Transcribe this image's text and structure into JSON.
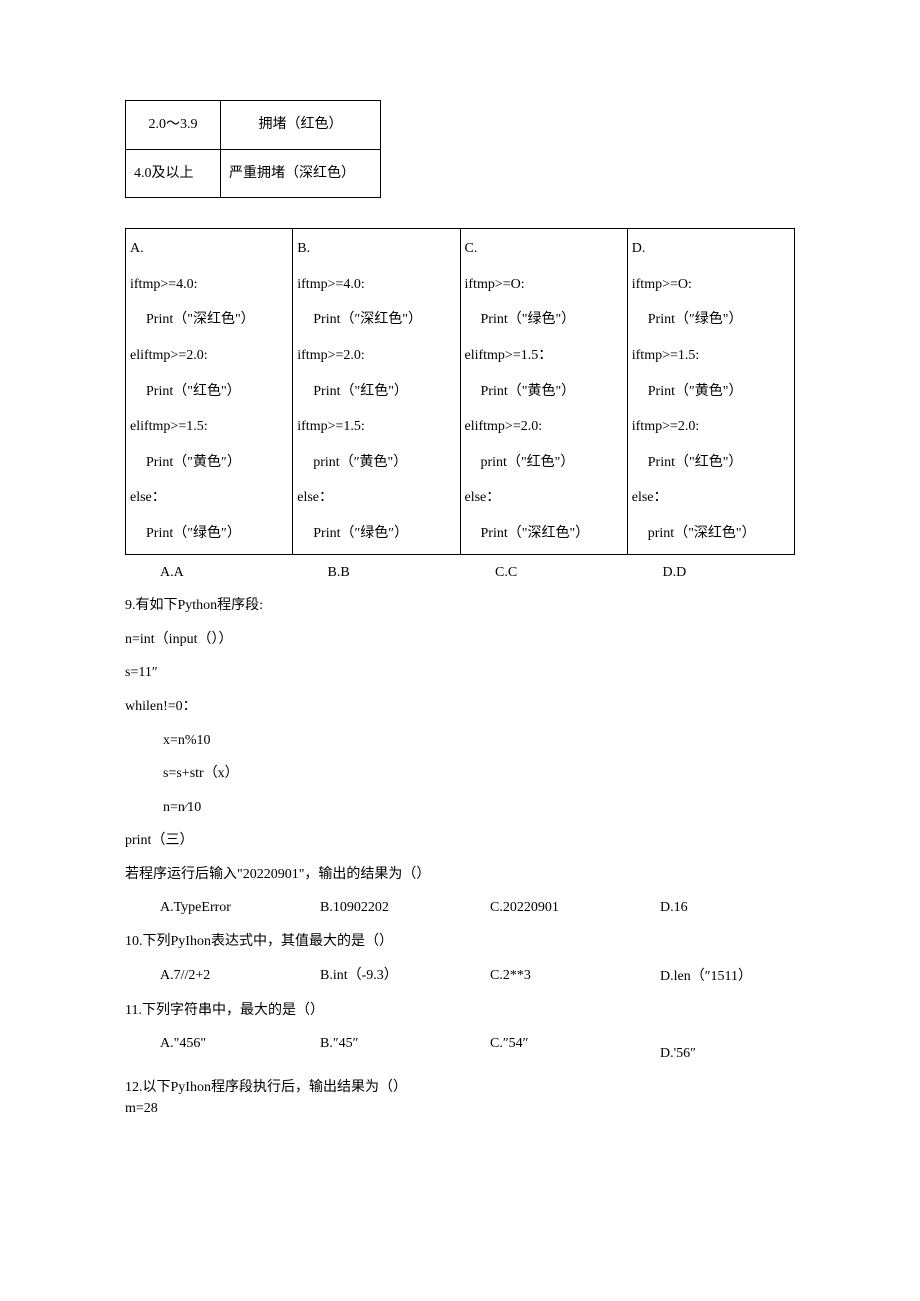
{
  "table1": {
    "r1c1": "2.0～3.9",
    "r1c2": "拥堵（红色）",
    "r2c1": "4.0及以上",
    "r2c2": "严重拥堵（深红色）"
  },
  "codeTable": {
    "A": {
      "header": "A.",
      "l1": "iftmp>=4.0:",
      "l2": "Print（\"深红色\"）",
      "l3": "eliftmp>=2.0:",
      "l4": "Print（\"红色\"）",
      "l5": "eliftmp>=1.5:",
      "l6": "Print（″黄色″）",
      "l7": "else：",
      "l8": "Print（″绿色″）"
    },
    "B": {
      "header": "B.",
      "l1": "iftmp>=4.0:",
      "l2": "Print（″深红色\"）",
      "l3": "iftmp>=2.0:",
      "l4": "Print（\"红色\"）",
      "l5": "iftmp>=1.5:",
      "l6": "print（″黄色\"）",
      "l7": "else：",
      "l8": "Print（″绿色″）"
    },
    "C": {
      "header": "C.",
      "l1": "iftmp>=O:",
      "l2": "Print（\"绿色\"）",
      "l3": "eliftmp>=1.5：",
      "l4": "Print（\"黄色\"）",
      "l5": "eliftmp>=2.0:",
      "l6": "print（\"红色\"）",
      "l7": "else：",
      "l8": "Print（\"深红色\"）"
    },
    "D": {
      "header": "D.",
      "l1": "iftmp>=O:",
      "l2": "Print（″绿色\"）",
      "l3": "iftmp>=1.5:",
      "l4": "Print（″黄色\"）",
      "l5": "iftmp>=2.0:",
      "l6": "Print（\"红色\"）",
      "l7": "else：",
      "l8": "print（\"深红色\"）"
    }
  },
  "opts8": {
    "A": "A.A",
    "B": "B.B",
    "C": "C.C",
    "D": "D.D"
  },
  "q9": {
    "title": "9.有如下Python程序段:",
    "l1": "n=int（input（））",
    "l2": "s=11″",
    "l3": "whilen!=0：",
    "l4": "x=n%10",
    "l5": "s=s+str（x）",
    "l6": "n=n⁄10",
    "l7": "print（三）",
    "prompt": "若程序运行后输入\"20220901\"，输出的结果为（）",
    "A": "A.TypeError",
    "B": "B.10902202",
    "C": "C.20220901",
    "D": "D.16"
  },
  "q10": {
    "title": "10.下列PyIhon表达式中，其值最大的是（）",
    "A": "A.7//2+2",
    "B": "B.int（-9.3）",
    "C": "C.2**3",
    "D": "D.len（″1511）"
  },
  "q11": {
    "title": "11.下列字符串中，最大的是（）",
    "A": "A.\"456\"",
    "B": "B.″45″",
    "C": "C.″54″",
    "D": "D.'56″"
  },
  "q12": {
    "title": "12.以下PyIhon程序段执行后，输出结果为（）",
    "l1": "m=28"
  }
}
